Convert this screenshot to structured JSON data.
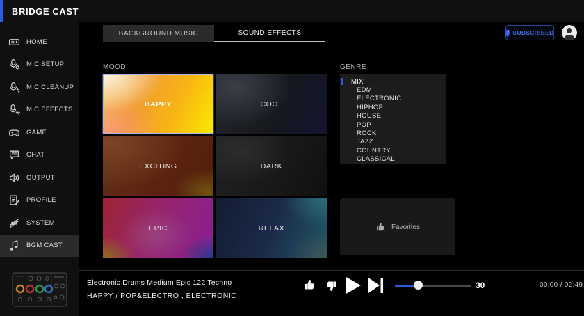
{
  "app": {
    "title": "BRIDGE CAST"
  },
  "header": {
    "subscribed_label": "SUBSCRIBED",
    "subscribed_check_icon": "check-circle-icon",
    "avatar_icon": "user-icon"
  },
  "sidebar": {
    "items": [
      {
        "label": "HOME",
        "icon": "home-device-icon",
        "active": false
      },
      {
        "label": "MIC SETUP",
        "icon": "mic-gear-icon",
        "active": false
      },
      {
        "label": "MIC CLEANUP",
        "icon": "mic-sparkle-icon",
        "active": false
      },
      {
        "label": "MIC EFFECTS",
        "icon": "mic-effects-icon",
        "active": false
      },
      {
        "label": "GAME",
        "icon": "gamepad-icon",
        "active": false
      },
      {
        "label": "CHAT",
        "icon": "chat-bubble-icon",
        "active": false
      },
      {
        "label": "OUTPUT",
        "icon": "speaker-icon",
        "active": false
      },
      {
        "label": "PROFILE",
        "icon": "document-pencil-icon",
        "active": false
      },
      {
        "label": "SYSTEM",
        "icon": "sliders-icon",
        "active": false
      },
      {
        "label": "BGM CAST",
        "icon": "music-note-icon",
        "active": true
      }
    ],
    "device_image": "bridge-cast-mixer-illustration"
  },
  "tabs": {
    "items": [
      {
        "label": "BACKGROUND MUSIC",
        "active": true
      },
      {
        "label": "SOUND EFFECTS",
        "active": false
      }
    ]
  },
  "mood": {
    "label": "MOOD",
    "tiles": [
      {
        "label": "HAPPY",
        "selected": true
      },
      {
        "label": "COOL",
        "selected": false
      },
      {
        "label": "EXCITING",
        "selected": false
      },
      {
        "label": "DARK",
        "selected": false
      },
      {
        "label": "EPIC",
        "selected": false
      },
      {
        "label": "RELAX",
        "selected": false
      }
    ]
  },
  "genre": {
    "label": "GENRE",
    "items": [
      {
        "label": "MIX",
        "selected": true
      },
      {
        "label": "EDM",
        "selected": false
      },
      {
        "label": "ELECTRONIC",
        "selected": false
      },
      {
        "label": "HIPHOP",
        "selected": false
      },
      {
        "label": "HOUSE",
        "selected": false
      },
      {
        "label": "POP",
        "selected": false
      },
      {
        "label": "ROCK",
        "selected": false
      },
      {
        "label": "JAZZ",
        "selected": false
      },
      {
        "label": "COUNTRY",
        "selected": false
      },
      {
        "label": "CLASSICAL",
        "selected": false
      }
    ]
  },
  "favorites": {
    "label": "Favorites",
    "icon": "thumbs-up-icon"
  },
  "player": {
    "track_title": "Electronic Drums Medium Epic 122 Techno",
    "track_meta": "HAPPY / POP&ELECTRO , ELECTRONIC",
    "controls": [
      "repeat-icon",
      "thumbs-up-icon",
      "thumbs-down-icon",
      "play-icon",
      "skip-next-icon"
    ],
    "volume_value": "30",
    "time": "00:00 / 02:49"
  },
  "colors": {
    "accent_blue": "#2e5be0",
    "subscribed_blue": "#3e6ae0",
    "active_row_gray": "#2b2b2b"
  }
}
